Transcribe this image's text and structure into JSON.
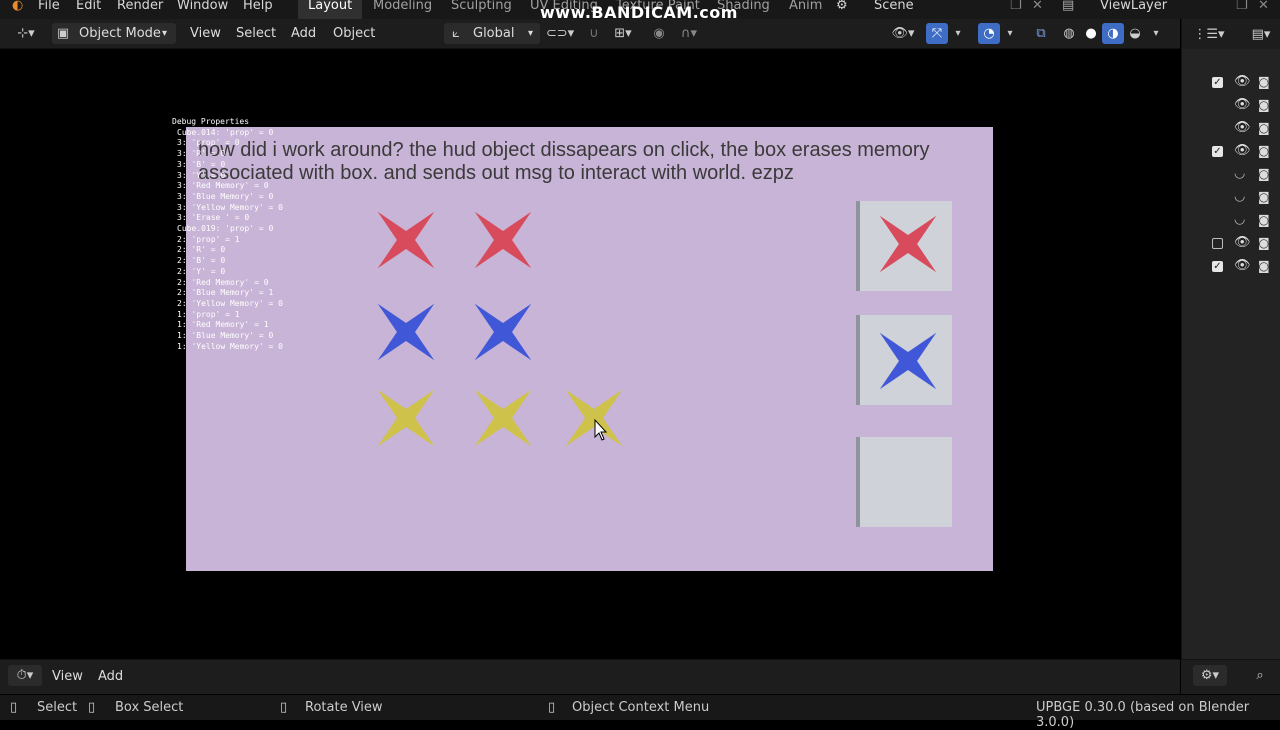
{
  "menu": {
    "items": [
      "File",
      "Edit",
      "Render",
      "Window",
      "Help"
    ],
    "workspaces": [
      "Layout",
      "Modeling",
      "Sculpting",
      "UV Editing",
      "Texture Paint",
      "Shading",
      "Anim"
    ],
    "active_workspace": "Layout",
    "scene_label": "Scene",
    "view_layer_label": "ViewLayer",
    "watermark": "www.BANDICAM.com"
  },
  "header": {
    "mode": "Object Mode",
    "view": "View",
    "select": "Select",
    "add": "Add",
    "object": "Object",
    "transform_orientation": "Global"
  },
  "game": {
    "hud_text": "how did i work around? the hud object dissapears on click, the box erases memory associated with box. and sends out msg to interact with world. ezpz",
    "stars": [
      {
        "color": "#d84b5c"
      },
      {
        "color": "#d84b5c"
      },
      {
        "color": "#4058d8"
      },
      {
        "color": "#4058d8"
      },
      {
        "color": "#cfc24a"
      },
      {
        "color": "#cfc24a"
      },
      {
        "color": "#cfc24a"
      }
    ],
    "boxes": [
      {
        "star_color": "#d84b5c"
      },
      {
        "star_color": "#4058d8"
      },
      {
        "star_color": ""
      }
    ]
  },
  "debug": {
    "title": "Debug Properties",
    "lines": [
      "Cube.014: 'prop' = 0",
      "3: 'prop' = 0",
      "3: 'R' = 0",
      "3: 'B' = 0",
      "3: 'Y' = 0",
      "3: 'Red Memory' = 0",
      "3: 'Blue Memory' = 0",
      "3: 'Yellow Memory' = 0",
      "3: 'Erase ' = 0",
      "Cube.019: 'prop' = 0",
      "2: 'prop' = 1",
      "2: 'R' = 0",
      "2: 'B' = 0",
      "2: 'Y' = 0",
      "2: 'Red Memory' = 0",
      "2: 'Blue Memory' = 1",
      "2: 'Yellow Memory' = 0",
      "1: 'prop' = 1",
      "1: 'Red Memory' = 1",
      "1: 'Blue Memory' = 0",
      "1: 'Yellow Memory' = 0"
    ]
  },
  "outliner": {
    "rows": [
      {
        "checked": true,
        "eye": "open"
      },
      {
        "checked": null,
        "eye": "open"
      },
      {
        "checked": null,
        "eye": "open"
      },
      {
        "checked": true,
        "eye": "open"
      },
      {
        "checked": null,
        "eye": "closed"
      },
      {
        "checked": null,
        "eye": "closed"
      },
      {
        "checked": null,
        "eye": "closed"
      },
      {
        "checked": false,
        "eye": "open"
      },
      {
        "checked": true,
        "eye": "open"
      }
    ]
  },
  "timeline": {
    "view": "View",
    "add": "Add"
  },
  "status": {
    "select": "Select",
    "box_select": "Box Select",
    "rotate_view": "Rotate View",
    "context_menu": "Object Context Menu",
    "version": "UPBGE 0.30.0 (based on Blender 3.0.0)"
  }
}
